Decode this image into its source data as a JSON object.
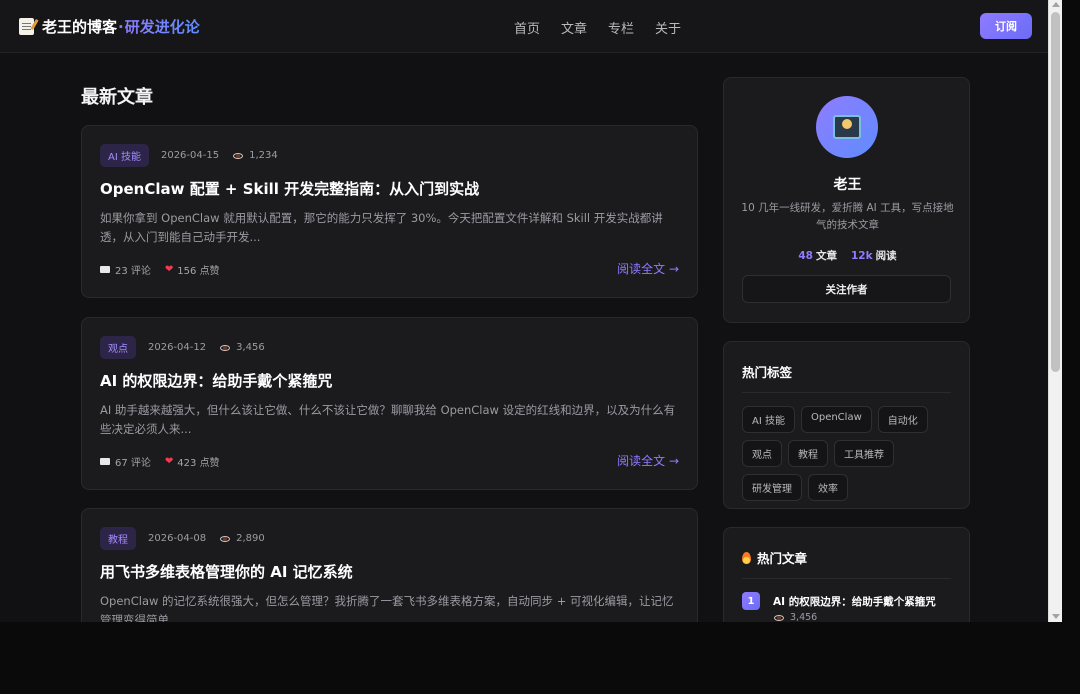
{
  "header": {
    "brand_main": "老王的博客",
    "brand_dot": "·",
    "brand_sub": "研发进化论",
    "brand_icon": "memo-icon",
    "nav": [
      "首页",
      "文章",
      "专栏",
      "关于"
    ],
    "subscribe_label": "订阅"
  },
  "main": {
    "section_title": "最新文章",
    "articles": [
      {
        "tag": "AI 技能",
        "date": "2026-04-15",
        "views": "1,234",
        "title": "OpenClaw 配置 + Skill 开发完整指南：从入门到实战",
        "excerpt": "如果你拿到 OpenClaw 就用默认配置，那它的能力只发挥了 30%。今天把配置文件详解和 Skill 开发实战都讲透，从入门到能自己动手开发...",
        "comments": "23 评论",
        "likes": "156 点赞",
        "read_more": "阅读全文 →"
      },
      {
        "tag": "观点",
        "date": "2026-04-12",
        "views": "3,456",
        "title": "AI 的权限边界：给助手戴个紧箍咒",
        "excerpt": "AI 助手越来越强大，但什么该让它做、什么不该让它做？聊聊我给 OpenClaw 设定的红线和边界，以及为什么有些决定必须人来...",
        "comments": "67 评论",
        "likes": "423 点赞",
        "read_more": "阅读全文 →"
      },
      {
        "tag": "教程",
        "date": "2026-04-08",
        "views": "2,890",
        "title": "用飞书多维表格管理你的 AI 记忆系统",
        "excerpt": "OpenClaw 的记忆系统很强大，但怎么管理？我折腾了一套飞书多维表格方案，自动同步 + 可视化编辑，让记忆管理变得简单..."
      }
    ]
  },
  "sidebar": {
    "author": {
      "name": "老王",
      "bio": "10 几年一线研发，爱折腾 AI 工具，写点接地气的技术文章",
      "articles_num": "48",
      "articles_label": "文章",
      "reads_num": "12k",
      "reads_label": "阅读",
      "follow_label": "关注作者"
    },
    "tags_title": "热门标签",
    "tags": [
      "AI 技能",
      "OpenClaw",
      "自动化",
      "观点",
      "教程",
      "工具推荐",
      "研发管理",
      "效率"
    ],
    "hot_title": "热门文章",
    "hot": [
      {
        "rank": "1",
        "title": "AI 的权限边界：给助手戴个紧箍咒",
        "views": "3,456"
      }
    ]
  },
  "colors": {
    "accent": "#8f7bff",
    "background": "#111113",
    "card": "#1b1b1e",
    "heart": "#ef3d4f"
  }
}
